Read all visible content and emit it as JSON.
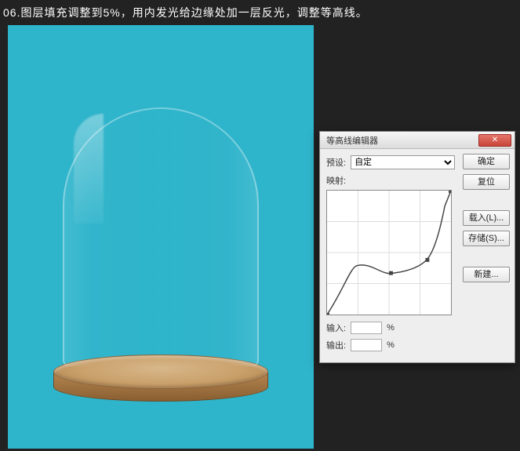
{
  "instruction": "06.图层填充调整到5%，用内发光给边缘处加一层反光，调整等高线。",
  "dialog": {
    "title": "等高线编辑器",
    "preset_label": "预设:",
    "preset_value": "自定",
    "mapping_label": "映射:",
    "input_label": "输入:",
    "output_label": "输出:",
    "percent_symbol": "%",
    "buttons": {
      "ok": "确定",
      "reset": "复位",
      "load": "载入(L)...",
      "save": "存储(S)...",
      "new": "新建..."
    }
  },
  "chart_data": {
    "type": "line",
    "description": "Contour curve mapping input (x 0-255) to output (y 0-255)",
    "xlim": [
      0,
      255
    ],
    "ylim": [
      0,
      255
    ],
    "points": [
      {
        "x": 0,
        "y": 0
      },
      {
        "x": 60,
        "y": 100
      },
      {
        "x": 130,
        "y": 85
      },
      {
        "x": 200,
        "y": 110
      },
      {
        "x": 235,
        "y": 200
      },
      {
        "x": 255,
        "y": 255
      }
    ],
    "grid": true
  }
}
